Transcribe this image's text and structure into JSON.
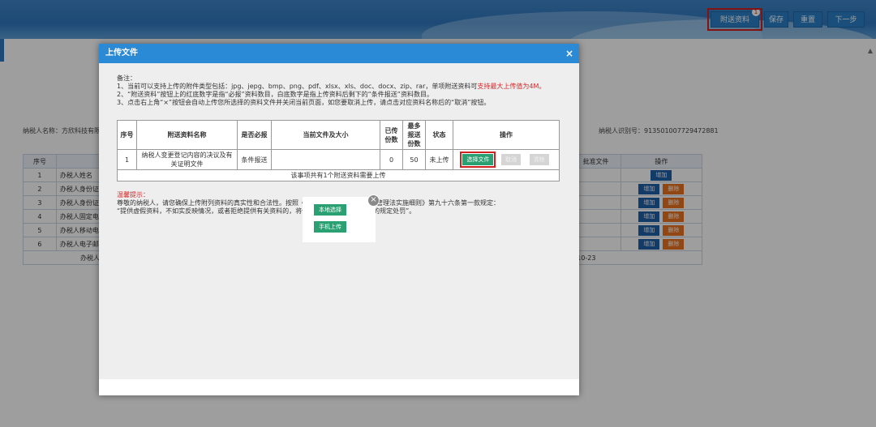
{
  "header": {
    "buttons": {
      "attach": "附送资料",
      "save": "保存",
      "reset": "重置",
      "next": "下一步"
    },
    "attach_badge": "1"
  },
  "background": {
    "taxpayer_name_label": "纳税人名称：方欣科技有限公",
    "taxpayer_id_label": "纳税人识别号：913501007729472881",
    "table": {
      "headers": [
        "序号",
        "",
        "批准文件",
        "操作"
      ],
      "rows": [
        {
          "no": "1",
          "name": "办税人姓名",
          "ops": [
            "增加"
          ]
        },
        {
          "no": "2",
          "name": "办税人身份证件",
          "ops": [
            "增加",
            "删除"
          ]
        },
        {
          "no": "3",
          "name": "办税人身份证件",
          "ops": [
            "增加",
            "删除"
          ]
        },
        {
          "no": "4",
          "name": "办税人固定电话",
          "ops": [
            "增加",
            "删除"
          ]
        },
        {
          "no": "5",
          "name": "办税人移动电话",
          "ops": [
            "增加",
            "删除"
          ]
        },
        {
          "no": "6",
          "name": "办税人电子邮箱",
          "ops": [
            "增加",
            "删除"
          ]
        }
      ],
      "footer_left": "办税人",
      "footer_date": "-10-23"
    }
  },
  "dialog": {
    "title": "上传文件",
    "close": "×",
    "notes": {
      "heading": "备注：",
      "line1": "1、当前可以支持上传的附件类型包括：jpg、jepg、bmp、png、pdf、xlsx、xls、doc、docx、zip、rar，单项附送资料可",
      "line1_red": "支持最大上传值为4M。",
      "line2": "2、“附送资料”按钮上的红底数字是指“必报”资料数目，白底数字是指上传资料后剩下的“条件报送”资料数目。",
      "line3": "3、点击右上角“×”按钮会自动上传您所选择的资料文件并关闭当前页面，如您要取消上传，请点击对应资料名称后的“取消”按钮。"
    },
    "table": {
      "headers": {
        "no": "序号",
        "name": "附送资料名称",
        "required": "是否必报",
        "current_file": "当前文件及大小",
        "uploaded": "已传份数",
        "max": "最多报送份数",
        "status": "状态",
        "ops": "操作"
      },
      "row": {
        "no": "1",
        "name": "纳税人变更登记内容的决议及有关证明文件",
        "required": "条件报送",
        "current_file": "",
        "uploaded": "0",
        "max": "50",
        "status": "未上传",
        "choose": "选择文件",
        "op2": "取消",
        "op3": "清除"
      },
      "summary": "该事项共有1个附送资料需要上传"
    },
    "tips": {
      "title": "温馨提示：",
      "line1": "尊敬的纳税人，请您确保上传附列资料的真实性和合法性。按照《中华人民共和国税收征收管理法实施细则》第九十六条第一款规定：",
      "line2": "“提供虚假资料，不如实反映情况，或者拒绝提供有关资料的，将依照税收征管法第七十条的规定处罚”。"
    }
  },
  "popup": {
    "local": "本地选择",
    "mobile": "手机上传",
    "close": "×"
  }
}
